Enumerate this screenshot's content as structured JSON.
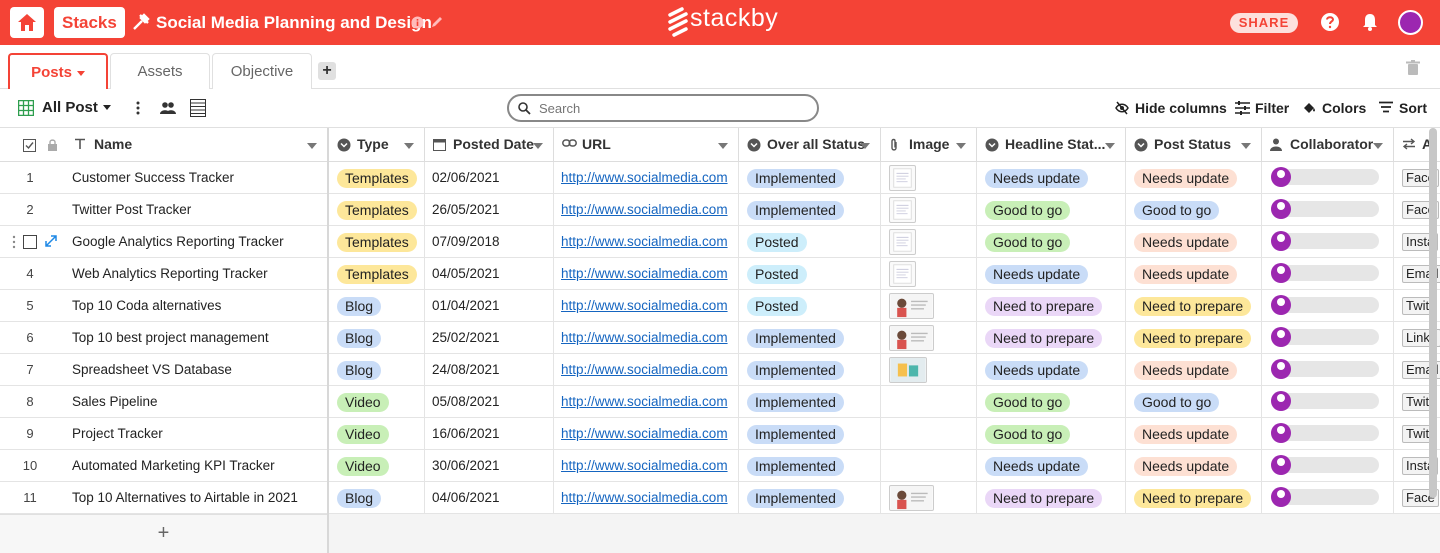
{
  "header": {
    "stacks_label": "Stacks",
    "stack_title": "Social Media Planning and Design",
    "logo_text": "stackby",
    "share_label": "SHARE",
    "brand_color": "#f44336"
  },
  "tabs": [
    {
      "label": "Posts",
      "active": true
    },
    {
      "label": "Assets",
      "active": false
    },
    {
      "label": "Objective",
      "active": false
    }
  ],
  "add_tab_label": "+",
  "toolbar": {
    "view_name": "All Post",
    "search_placeholder": "Search",
    "hide_columns": "Hide columns",
    "filter": "Filter",
    "colors": "Colors",
    "sort": "Sort"
  },
  "columns": [
    "Name",
    "Type",
    "Posted Date",
    "URL",
    "Over all Status",
    "Image",
    "Headline Stat...",
    "Post Status",
    "Collaborator",
    "A"
  ],
  "add_row_label": "+",
  "rows": [
    {
      "num": "1",
      "name": "Customer Success Tracker",
      "type": "Templates",
      "date": "02/06/2021",
      "url": "http://www.socialmedia.com",
      "overall": "Implemented",
      "image": "doc",
      "headline": "Needs update",
      "post": "Needs update",
      "assign": "Face"
    },
    {
      "num": "2",
      "name": "Twitter Post Tracker",
      "type": "Templates",
      "date": "26/05/2021",
      "url": "http://www.socialmedia.com",
      "overall": "Implemented",
      "image": "doc",
      "headline": "Good to go",
      "post": "Good to go",
      "assign": "Face"
    },
    {
      "num": "",
      "name": "Google Analytics Reporting Tracker",
      "type": "Templates",
      "date": "07/09/2018",
      "url": "http://www.socialmedia.com",
      "overall": "Posted",
      "image": "doc",
      "headline": "Good to go",
      "post": "Needs update",
      "assign": "Insta"
    },
    {
      "num": "4",
      "name": "Web Analytics Reporting Tracker",
      "type": "Templates",
      "date": "04/05/2021",
      "url": "http://www.socialmedia.com",
      "overall": "Posted",
      "image": "doc",
      "headline": "Needs update",
      "post": "Needs update",
      "assign": "Email"
    },
    {
      "num": "5",
      "name": "Top 10 Coda alternatives",
      "type": "Blog",
      "date": "01/04/2021",
      "url": "http://www.socialmedia.com",
      "overall": "Posted",
      "image": "photo",
      "headline": "Need to prepare",
      "post": "Need to prepare",
      "assign": "Twitt"
    },
    {
      "num": "6",
      "name": "Top 10 best project management",
      "type": "Blog",
      "date": "25/02/2021",
      "url": "http://www.socialmedia.com",
      "overall": "Implemented",
      "image": "photo",
      "headline": "Need to prepare",
      "post": "Need to prepare",
      "assign": "Linke"
    },
    {
      "num": "7",
      "name": "Spreadsheet VS Database",
      "type": "Blog",
      "date": "24/08/2021",
      "url": "http://www.socialmedia.com",
      "overall": "Implemented",
      "image": "small",
      "headline": "Needs update",
      "post": "Needs update",
      "assign": "Email"
    },
    {
      "num": "8",
      "name": "Sales Pipeline",
      "type": "Video",
      "date": "05/08/2021",
      "url": "http://www.socialmedia.com",
      "overall": "Implemented",
      "image": "",
      "headline": "Good to go",
      "post": "Good to go",
      "assign": "Twitt"
    },
    {
      "num": "9",
      "name": "Project Tracker",
      "type": "Video",
      "date": "16/06/2021",
      "url": "http://www.socialmedia.com",
      "overall": "Implemented",
      "image": "",
      "headline": "Good to go",
      "post": "Needs update",
      "assign": "Twitt"
    },
    {
      "num": "10",
      "name": "Automated Marketing KPI Tracker",
      "type": "Video",
      "date": "30/06/2021",
      "url": "http://www.socialmedia.com",
      "overall": "Implemented",
      "image": "",
      "headline": "Needs update",
      "post": "Needs update",
      "assign": "Insta"
    },
    {
      "num": "11",
      "name": "Top 10 Alternatives to Airtable in 2021",
      "type": "Blog",
      "date": "04/06/2021",
      "url": "http://www.socialmedia.com",
      "overall": "Implemented",
      "image": "photo",
      "headline": "Need to prepare",
      "post": "Need to prepare",
      "assign": "Face"
    }
  ],
  "chip_colors": {
    "Templates": "#fde79a",
    "Blog": "#c9dcf7",
    "Video": "#c8efb7",
    "Implemented": "#c9dcf7",
    "Posted": "#cdeefb",
    "Needs update": "#c9dcf7",
    "Good to go": "#c8efb7",
    "Need to prepare": "#ead7f7",
    "Post:Needs update": "#fde0d3",
    "Post:Good to go": "#c9dcf7",
    "Post:Need to prepare": "#fde79a"
  }
}
